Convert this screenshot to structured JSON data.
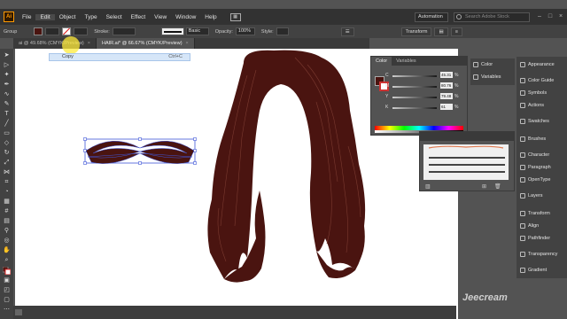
{
  "app": {
    "logo": "Ai"
  },
  "menu": [
    "File",
    "Edit",
    "Object",
    "Type",
    "Select",
    "Effect",
    "View",
    "Window",
    "Help"
  ],
  "menu_active": "Edit",
  "workspace": "Automation",
  "stock_search": {
    "placeholder": "Search Adobe Stock"
  },
  "control": {
    "group_label": "Group",
    "stroke_label": "Stroke:",
    "brush_label": "Basic",
    "opacity_label": "Opacity:",
    "opacity_value": "100%",
    "style_label": "Style:",
    "transform_label": "Transform",
    "fill_color": "#4a1410"
  },
  "tabs": [
    {
      "label": "ai @ 49.68% (CMYK/Preview)",
      "active": false
    },
    {
      "label": "HAIR.ai* @ 66.67% (CMYK/Preview)",
      "active": true
    }
  ],
  "flyout": {
    "label": "Copy",
    "shortcut": "Ctrl+C"
  },
  "color_panel": {
    "tabs": [
      "Color",
      "Variables"
    ],
    "channels": [
      {
        "name": "C",
        "value": "45.31",
        "unit": "%"
      },
      {
        "name": "M",
        "value": "80.76",
        "unit": "%"
      },
      {
        "name": "Y",
        "value": "79.48",
        "unit": "%"
      },
      {
        "name": "K",
        "value": "61",
        "unit": "%"
      }
    ]
  },
  "dock_small": [
    "Color",
    "Variables"
  ],
  "dock": [
    "Appearance",
    "Color Guide",
    "Symbols",
    "Actions",
    "Swatches",
    "Brushes",
    "Character",
    "Paragraph",
    "OpenType",
    "Layers",
    "Transform",
    "Align",
    "Pathfinder",
    "Transparency",
    "Gradient"
  ],
  "colors": {
    "hair": "#4a1410",
    "hair_line": "#7a3a30",
    "selection": "#3f56d8"
  },
  "watermark": "Jeecream"
}
